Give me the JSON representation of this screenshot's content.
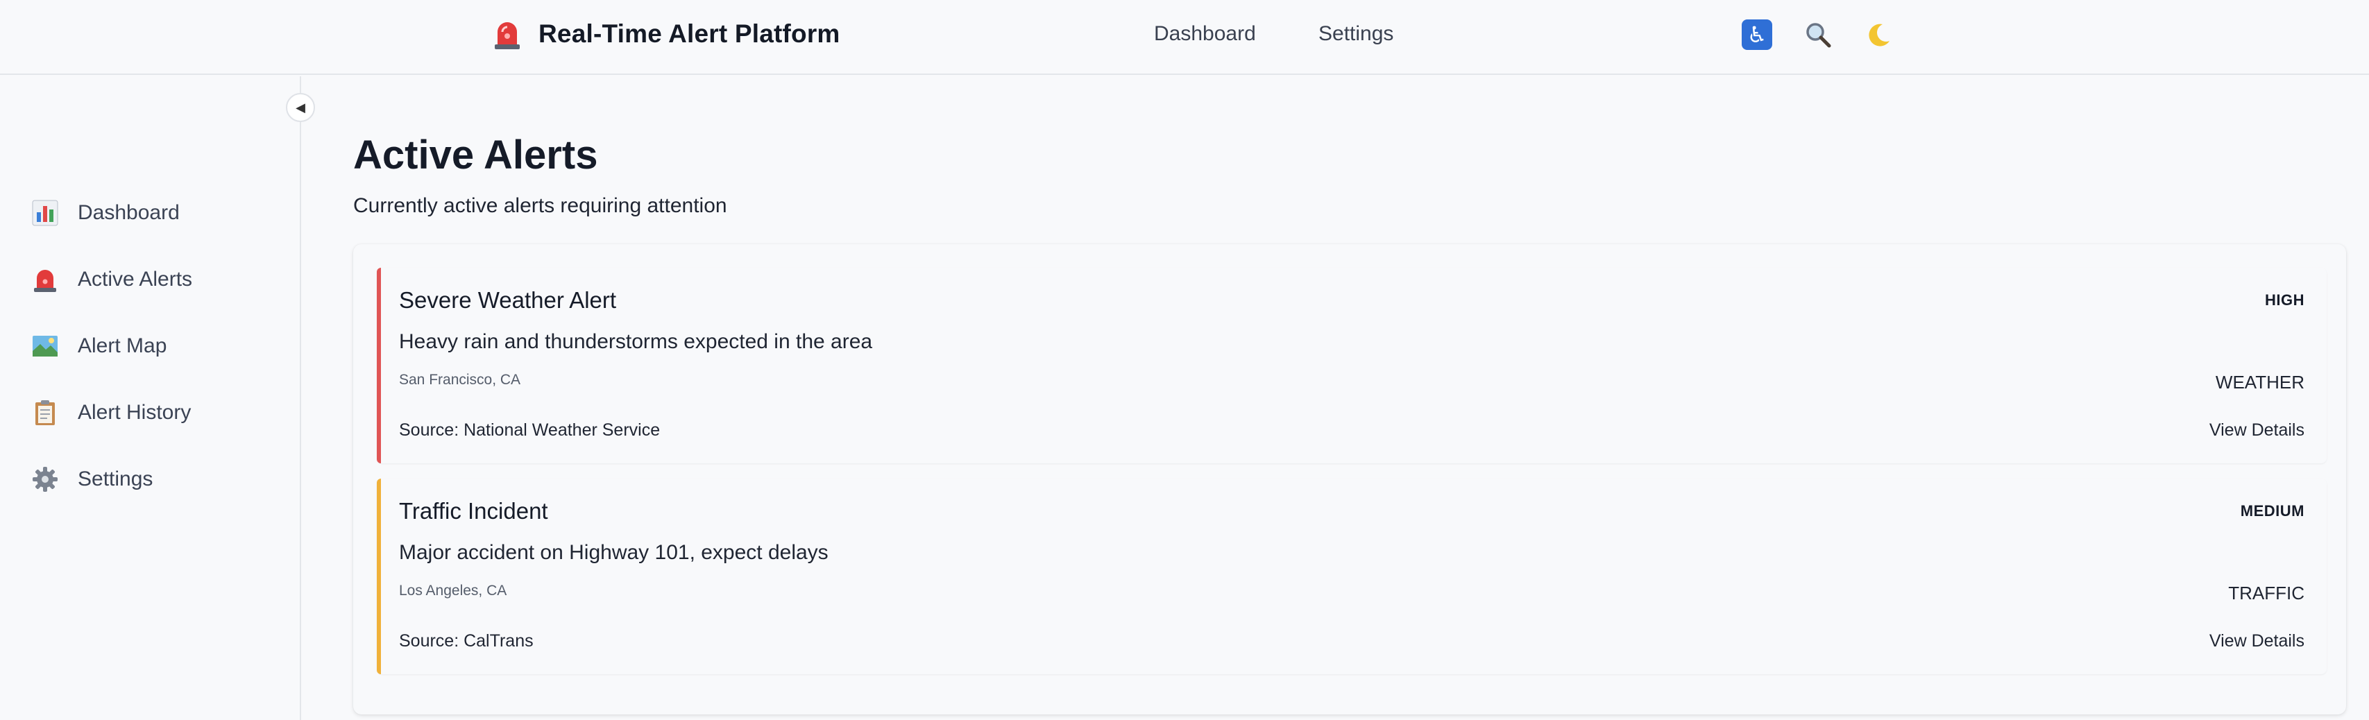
{
  "header": {
    "title": "Real-Time Alert Platform",
    "nav": [
      {
        "label": "Dashboard"
      },
      {
        "label": "Settings"
      }
    ],
    "tools": {
      "accessibility_icon": "accessibility-icon",
      "search_icon": "search-icon",
      "theme_icon": "moon-icon"
    }
  },
  "sidebar": {
    "collapse_icon": "◀",
    "items": [
      {
        "label": "Dashboard",
        "icon": "bar-chart-icon"
      },
      {
        "label": "Active Alerts",
        "icon": "siren-icon"
      },
      {
        "label": "Alert Map",
        "icon": "map-icon"
      },
      {
        "label": "Alert History",
        "icon": "clipboard-icon"
      },
      {
        "label": "Settings",
        "icon": "gear-icon"
      }
    ]
  },
  "main": {
    "title": "Active Alerts",
    "subtitle": "Currently active alerts requiring attention",
    "alerts": [
      {
        "title": "Severe Weather Alert",
        "description": "Heavy rain and thunderstorms expected in the area",
        "location": "San Francisco, CA",
        "source": "Source: National Weather Service",
        "severity": "HIGH",
        "category": "WEATHER",
        "action": "View Details",
        "accent": "#e05555"
      },
      {
        "title": "Traffic Incident",
        "description": "Major accident on Highway 101, expect delays",
        "location": "Los Angeles, CA",
        "source": "Source: CalTrans",
        "severity": "MEDIUM",
        "category": "TRAFFIC",
        "action": "View Details",
        "accent": "#f0b13a"
      }
    ]
  },
  "colors": {
    "high": "#e05555",
    "medium": "#f0b13a",
    "accessibility": "#2f6fd6"
  }
}
